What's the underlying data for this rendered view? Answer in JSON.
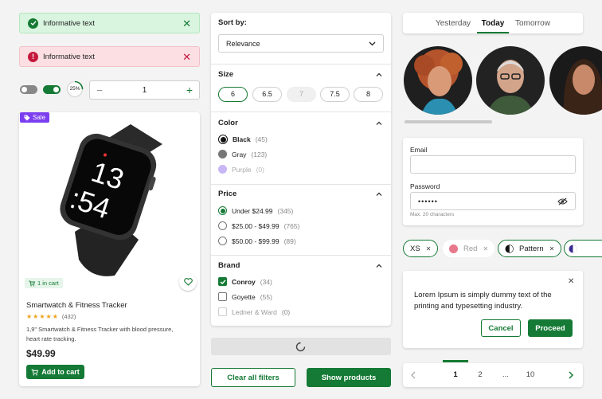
{
  "toasts": {
    "success_text": "Informative text",
    "error_text": "Informative text",
    "close_glyph": "✕"
  },
  "controls": {
    "progress_label": "25%",
    "progress_value": 0.25,
    "stepper_minus": "−",
    "stepper_value": "1",
    "stepper_plus": "+"
  },
  "product": {
    "sale_badge": "Sale",
    "in_cart_label": "1 in cart",
    "name": "Smartwatch & Fitness Tracker",
    "stars": "★★★★★",
    "rating_count": "(432)",
    "description_line1": "1,9\" Smartwatch & Fitness Tracker with blood pressure,",
    "description_line2": "heart rate tracking.",
    "price": "$49.99",
    "add_to_cart_label": "Add to cart",
    "watch_time_hours": "13",
    "watch_time_minutes": ":54"
  },
  "filters": {
    "sort_label": "Sort by:",
    "sort_value": "Relevance",
    "size_title": "Size",
    "sizes": [
      "6",
      "6.5",
      "7",
      "7.5",
      "8"
    ],
    "color_title": "Color",
    "colors": [
      {
        "label": "Black",
        "count": "(45)",
        "hex": "#111111"
      },
      {
        "label": "Gray",
        "count": "(123)",
        "hex": "#777777"
      },
      {
        "label": "Purple",
        "count": "(0)",
        "hex": "#c9b6f5"
      }
    ],
    "price_title": "Price",
    "prices": [
      {
        "label": "Under $24.99",
        "count": "(345)"
      },
      {
        "label": "$25.00 - $49.99",
        "count": "(765)"
      },
      {
        "label": "$50.00 - $99.99",
        "count": "(89)"
      }
    ],
    "brand_title": "Brand",
    "brands": [
      {
        "label": "Conroy",
        "count": "(34)"
      },
      {
        "label": "Goyette",
        "count": "(55)"
      },
      {
        "label": "Ledner & Ward",
        "count": "(0)"
      }
    ],
    "clear_label": "Clear all filters",
    "show_label": "Show products"
  },
  "tabs": [
    "Yesterday",
    "Today",
    "Tomorrow"
  ],
  "form": {
    "email_label": "Email",
    "password_label": "Password",
    "password_value": "••••••",
    "hint": "Max. 20 characters"
  },
  "chips": [
    {
      "label": "XS"
    },
    {
      "label": "Red",
      "hex": "#e8788c"
    },
    {
      "label": "Pattern"
    }
  ],
  "dialog": {
    "text_line1": "Lorem Ipsum is simply dummy text of the",
    "text_line2": "printing and typesetting industry.",
    "cancel_label": "Cancel",
    "proceed_label": "Proceed"
  },
  "pagination": {
    "pages": [
      "1",
      "2",
      "...",
      "10"
    ]
  },
  "colors": {
    "accent": "#157a35",
    "success_bg": "#d9f5df",
    "error_bg": "#fbdfe3",
    "error": "#c4183c",
    "sale": "#7c3ff0"
  }
}
